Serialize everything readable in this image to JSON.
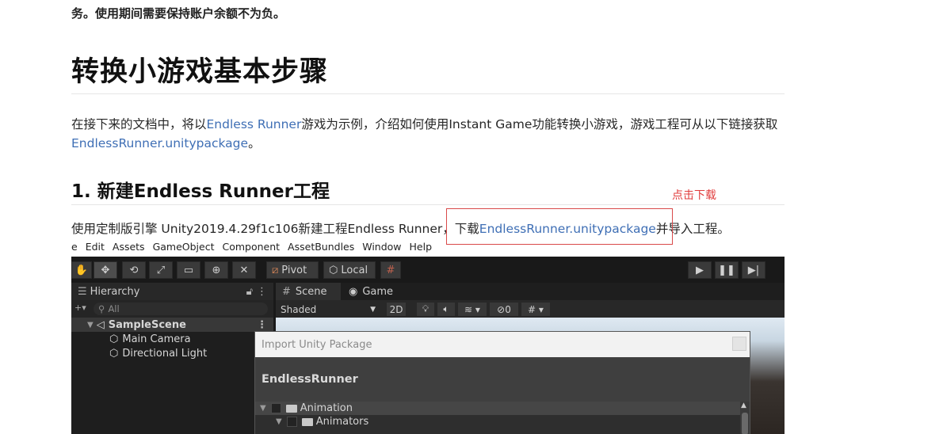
{
  "intro_tail": "务。使用期间需要保持账户余额不为负。",
  "h1": "转换小游戏基本步骤",
  "p1": {
    "pre": "在接下来的文档中，将以",
    "link1": "Endless Runner",
    "mid": "游戏为示例，介绍如何使用Instant Game功能转换小游戏，游戏工程可从以下链接获取",
    "link2": "EndlessRunner.unitypackage",
    "post": "。"
  },
  "h2": "1. 新建Endless Runner工程",
  "annotation": "点击下载",
  "p2": {
    "pre": "使用定制版引擎 Unity2019.4.29f1c106新建工程Endless Runner，下载",
    "link": "EndlessRunner.unitypackage",
    "post": "并导入工程。"
  },
  "unity": {
    "menu": [
      "e",
      "Edit",
      "Assets",
      "GameObject",
      "Component",
      "AssetBundles",
      "Window",
      "Help"
    ],
    "toolbar": {
      "pivot": "Pivot",
      "local": "Local"
    },
    "hierarchy": {
      "tab": "Hierarchy",
      "search_placeholder": "All",
      "scene": "SampleScene",
      "items": [
        "Main Camera",
        "Directional Light"
      ]
    },
    "scene_tabs": {
      "scene": "Scene",
      "game": "Game"
    },
    "scene_bar": {
      "shading": "Shaded",
      "mode2d": "2D",
      "hidden_count": "0"
    },
    "dialog": {
      "title": "Import Unity Package",
      "package": "EndlessRunner",
      "rows": [
        "Animation",
        "Animators"
      ]
    }
  },
  "colors": {
    "link": "#3f6fb5",
    "annotation": "#e03c3c",
    "editor_bg": "#191919"
  }
}
